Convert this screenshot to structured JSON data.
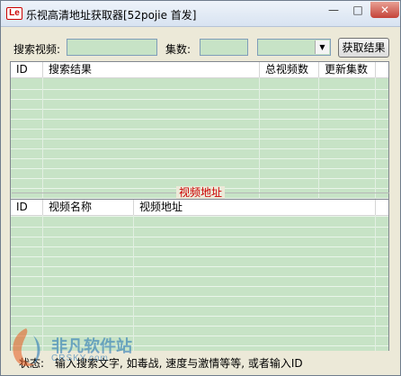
{
  "window": {
    "title": "乐视高清地址获取器[52pojie 首发]",
    "icon_text": "Le",
    "minimize": "—",
    "maximize": "□",
    "close": "✕"
  },
  "search": {
    "label": "搜索视频:",
    "value": "",
    "episodes_label": "集数:",
    "episodes_value": "",
    "combo_value": "",
    "get_button": "获取结果"
  },
  "results_table": {
    "columns": [
      "ID",
      "搜索结果",
      "总视频数",
      "更新集数"
    ]
  },
  "video_section": {
    "title": "视频地址",
    "columns": [
      "ID",
      "视频名称",
      "视频地址"
    ]
  },
  "status": {
    "label": "状态:",
    "text": "输入搜索文字, 如毒战, 速度与激情等等, 或者输入ID"
  },
  "watermark": {
    "cn": "非凡软件站",
    "en": "CRSKY.com"
  },
  "colors": {
    "list_bg": "#c7e3c6",
    "accent_red": "#cc0000",
    "window_bg": "#ece9d8"
  }
}
